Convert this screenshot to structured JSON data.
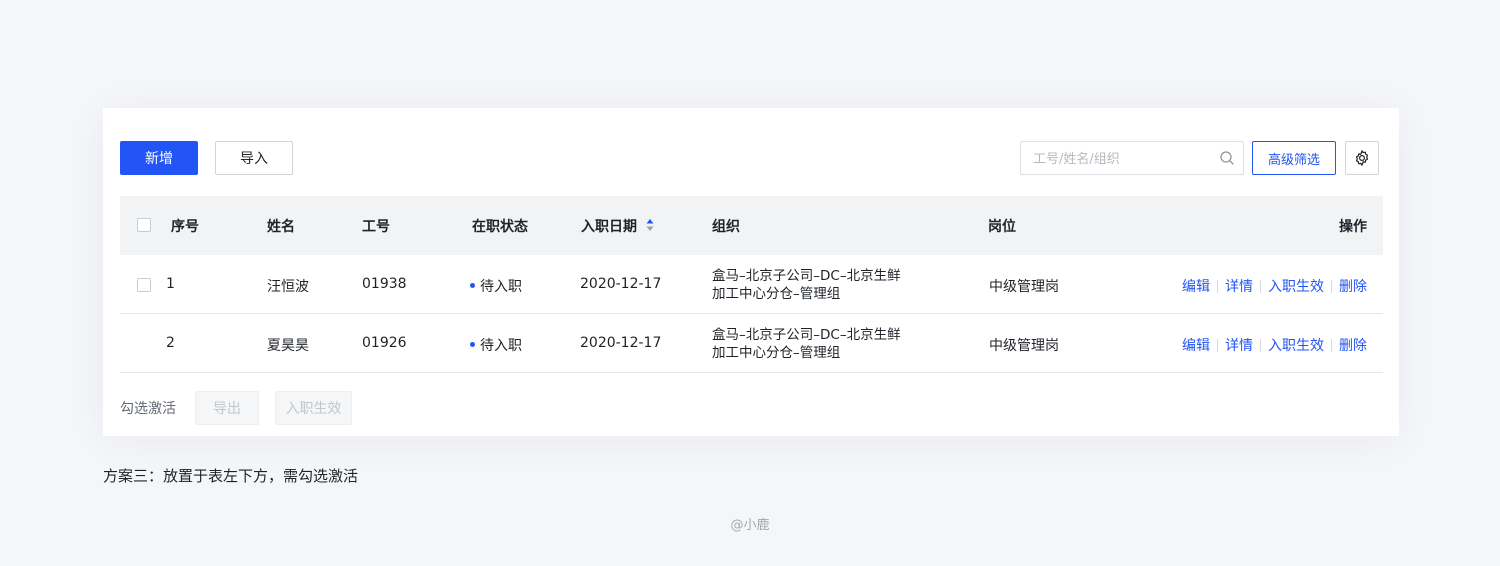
{
  "toolbar": {
    "add_label": "新增",
    "import_label": "导入",
    "search_placeholder": "工号/姓名/组织",
    "advanced_filter_label": "高级筛选"
  },
  "table": {
    "columns": [
      "序号",
      "姓名",
      "工号",
      "在职状态",
      "入职日期",
      "组织",
      "岗位",
      "操作"
    ],
    "rows": [
      {
        "index": "1",
        "name": "汪恒波",
        "id": "01938",
        "status": "待入职",
        "date": "2020-12-17",
        "org_line1": "盒马–北京子公司–DC–北京生鲜",
        "org_line2": "加工中心分仓–管理组",
        "position": "中级管理岗",
        "actions": [
          "编辑",
          "详情",
          "入职生效",
          "删除"
        ]
      },
      {
        "index": "2",
        "name": "夏昊昊",
        "id": "01926",
        "status": "待入职",
        "date": "2020-12-17",
        "org_line1": "盒马–北京子公司–DC–北京生鲜",
        "org_line2": "加工中心分仓–管理组",
        "position": "中级管理岗",
        "actions": [
          "编辑",
          "详情",
          "入职生效",
          "删除"
        ]
      }
    ]
  },
  "footer": {
    "label": "勾选激活",
    "export_label": "导出",
    "activate_label": "入职生效"
  },
  "caption": "方案三：放置于表左下方，需勾选激活",
  "credit": "@小鹿",
  "colors": {
    "primary": "#2354f5",
    "header_bg": "#f2f3f5",
    "page_bg": "#f5f6f8"
  }
}
